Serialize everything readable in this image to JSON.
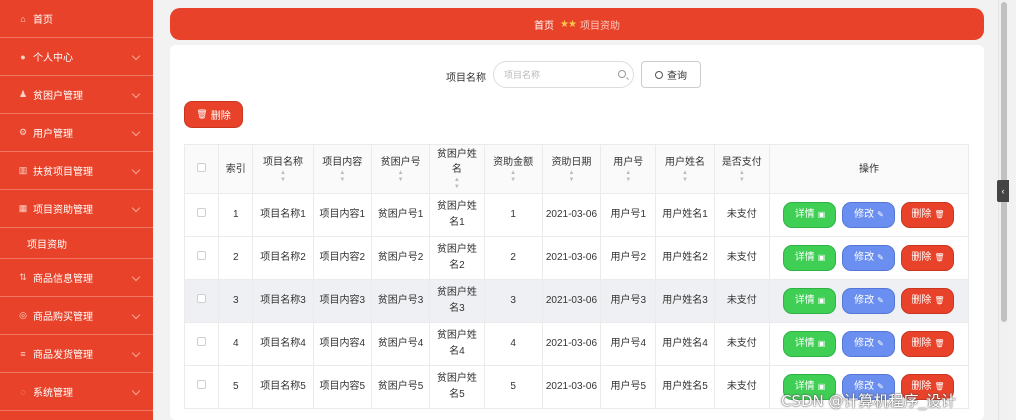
{
  "sidebar": {
    "items": [
      {
        "label": "首页",
        "icon": "home-icon",
        "glyph": "⌂",
        "chevron": false
      },
      {
        "label": "个人中心",
        "icon": "user-icon",
        "glyph": "●",
        "chevron": true
      },
      {
        "label": "贫困户管理",
        "icon": "people-icon",
        "glyph": "♟",
        "chevron": true
      },
      {
        "label": "用户管理",
        "icon": "gear-icon",
        "glyph": "⚙",
        "chevron": true
      },
      {
        "label": "扶贫项目管理",
        "icon": "bank-icon",
        "glyph": "▥",
        "chevron": true
      },
      {
        "label": "项目资助管理",
        "icon": "grid-icon",
        "glyph": "▦",
        "chevron": true,
        "expanded": true,
        "children": [
          "项目资助"
        ]
      },
      {
        "label": "商品信息管理",
        "icon": "link-icon",
        "glyph": "⇅",
        "chevron": true
      },
      {
        "label": "商品购买管理",
        "icon": "cart-icon",
        "glyph": "◎",
        "chevron": true
      },
      {
        "label": "商品发货管理",
        "icon": "list-icon",
        "glyph": "≡",
        "chevron": true
      },
      {
        "label": "系统管理",
        "icon": "settings-icon",
        "glyph": "◌",
        "chevron": true
      }
    ]
  },
  "breadcrumb": {
    "home": "首页",
    "stars": "★★",
    "current": "项目资助"
  },
  "search": {
    "label": "项目名称",
    "placeholder": "项目名称",
    "value": "",
    "button_label": "查询"
  },
  "batch_delete_label": "删除",
  "table": {
    "columns": [
      "",
      "索引",
      "项目名称",
      "项目内容",
      "贫困户号",
      "贫困户姓名",
      "资助金额",
      "资助日期",
      "用户号",
      "用户姓名",
      "是否支付",
      "操作"
    ],
    "rows": [
      {
        "index": "1",
        "name": "项目名称1",
        "content": "项目内容1",
        "household_no": "贫困户号1",
        "household_name": "贫困户姓名1",
        "amount": "1",
        "date": "2021-03-06",
        "user_no": "用户号1",
        "user_name": "用户姓名1",
        "paid": "未支付"
      },
      {
        "index": "2",
        "name": "项目名称2",
        "content": "项目内容2",
        "household_no": "贫困户号2",
        "household_name": "贫困户姓名2",
        "amount": "2",
        "date": "2021-03-06",
        "user_no": "用户号2",
        "user_name": "用户姓名2",
        "paid": "未支付"
      },
      {
        "index": "3",
        "name": "项目名称3",
        "content": "项目内容3",
        "household_no": "贫困户号3",
        "household_name": "贫困户姓名3",
        "amount": "3",
        "date": "2021-03-06",
        "user_no": "用户号3",
        "user_name": "用户姓名3",
        "paid": "未支付",
        "highlight": true
      },
      {
        "index": "4",
        "name": "项目名称4",
        "content": "项目内容4",
        "household_no": "贫困户号4",
        "household_name": "贫困户姓名4",
        "amount": "4",
        "date": "2021-03-06",
        "user_no": "用户号4",
        "user_name": "用户姓名4",
        "paid": "未支付"
      },
      {
        "index": "5",
        "name": "项目名称5",
        "content": "项目内容5",
        "household_no": "贫困户号5",
        "household_name": "贫困户姓名5",
        "amount": "5",
        "date": "2021-03-06",
        "user_no": "用户号5",
        "user_name": "用户姓名5",
        "paid": "未支付"
      }
    ],
    "actions": {
      "detail": "详情",
      "edit": "修改",
      "delete": "删除"
    }
  },
  "watermark": "CSDN @计算机程序_设计",
  "colors": {
    "primary": "#e8432a",
    "detail": "#3fcf55",
    "edit": "#6b8ff0",
    "delete": "#e8432a"
  }
}
